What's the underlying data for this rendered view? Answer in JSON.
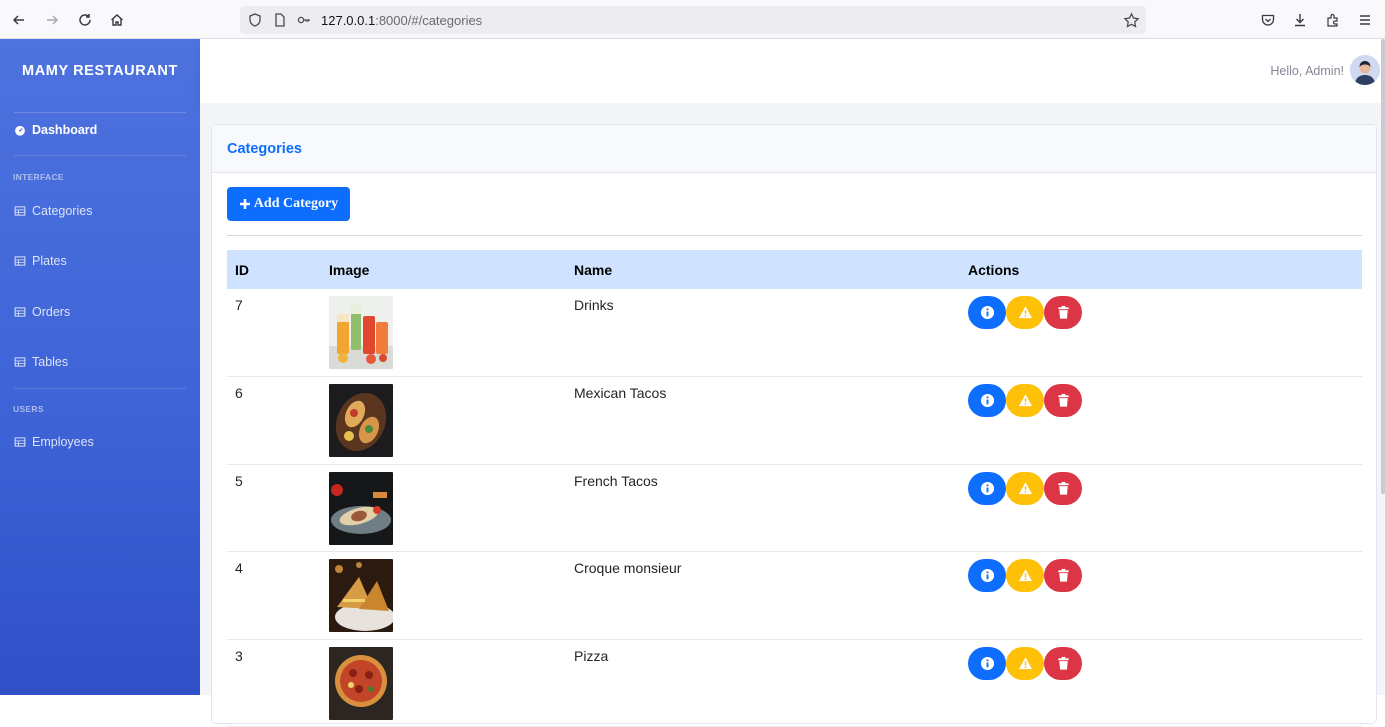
{
  "browser": {
    "url_host": "127.0.0.1",
    "url_rest": ":8000/#/categories"
  },
  "sidebar": {
    "brand": "MAMY RESTAURANT",
    "dashboard": "Dashboard",
    "section_interface": "INTERFACE",
    "section_users": "USERS",
    "items": [
      {
        "label": "Categories"
      },
      {
        "label": "Plates"
      },
      {
        "label": "Orders"
      },
      {
        "label": "Tables"
      },
      {
        "label": "Employees"
      }
    ]
  },
  "topbar": {
    "greeting": "Hello, Admin!"
  },
  "card": {
    "title": "Categories",
    "add_button": "Add Category"
  },
  "table": {
    "headers": [
      "ID",
      "Image",
      "Name",
      "Actions"
    ],
    "rows": [
      {
        "id": "7",
        "name": "Drinks",
        "image": "drinks-photo"
      },
      {
        "id": "6",
        "name": "Mexican Tacos",
        "image": "mexican-tacos-photo"
      },
      {
        "id": "5",
        "name": "French Tacos",
        "image": "french-tacos-photo"
      },
      {
        "id": "4",
        "name": "Croque monsieur",
        "image": "croque-monsieur-photo"
      },
      {
        "id": "3",
        "name": "Pizza",
        "image": "pizza-photo"
      }
    ]
  },
  "colors": {
    "sidebar": "#4e73df",
    "primary": "#0d6efd",
    "warning": "#ffc107",
    "danger": "#dc3545",
    "table_header": "#cfe2ff"
  }
}
